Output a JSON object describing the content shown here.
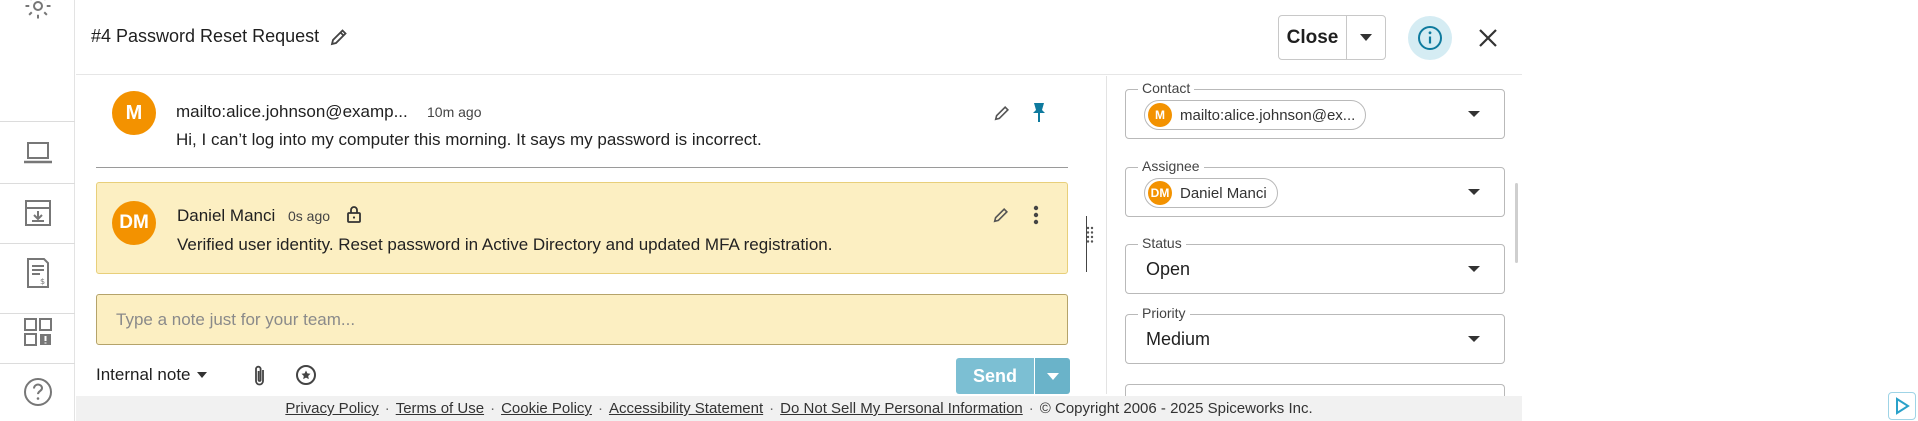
{
  "header": {
    "title": "#4 Password Reset Request",
    "close_label": "Close"
  },
  "messages": [
    {
      "avatar": "M",
      "sender": "mailto:alice.johnson@examp...",
      "time": "10m ago",
      "text": "Hi, I can’t log into my computer this morning. It says my password is incorrect."
    },
    {
      "avatar": "DM",
      "sender": "Daniel Manci",
      "time": "0s ago",
      "text": "Verified user identity. Reset password in Active Directory and updated MFA registration."
    }
  ],
  "compose": {
    "placeholder": "Type a note just for your team...",
    "mode_label": "Internal note",
    "send_label": "Send"
  },
  "panel": {
    "contact": {
      "label": "Contact",
      "chip_avatar": "M",
      "chip_text": "mailto:alice.johnson@ex..."
    },
    "assignee": {
      "label": "Assignee",
      "chip_avatar": "DM",
      "chip_text": "Daniel Manci"
    },
    "status": {
      "label": "Status",
      "value": "Open"
    },
    "priority": {
      "label": "Priority",
      "value": "Medium"
    }
  },
  "footer": {
    "links": [
      "Privacy Policy",
      "Terms of Use",
      "Cookie Policy",
      "Accessibility Statement",
      "Do Not Sell My Personal Information"
    ],
    "copyright": "© Copyright 2006 - 2025 Spiceworks Inc."
  },
  "colors": {
    "accent": "#0e7a9e",
    "avatar": "#f39200",
    "note_bg": "#fcefc2",
    "send_btn": "#7cbfd3"
  },
  "icons": {
    "rail": [
      "gear-icon",
      "laptop-icon",
      "inbox-download-icon",
      "invoice-icon",
      "dashboard-alert-icon",
      "help-icon"
    ]
  }
}
